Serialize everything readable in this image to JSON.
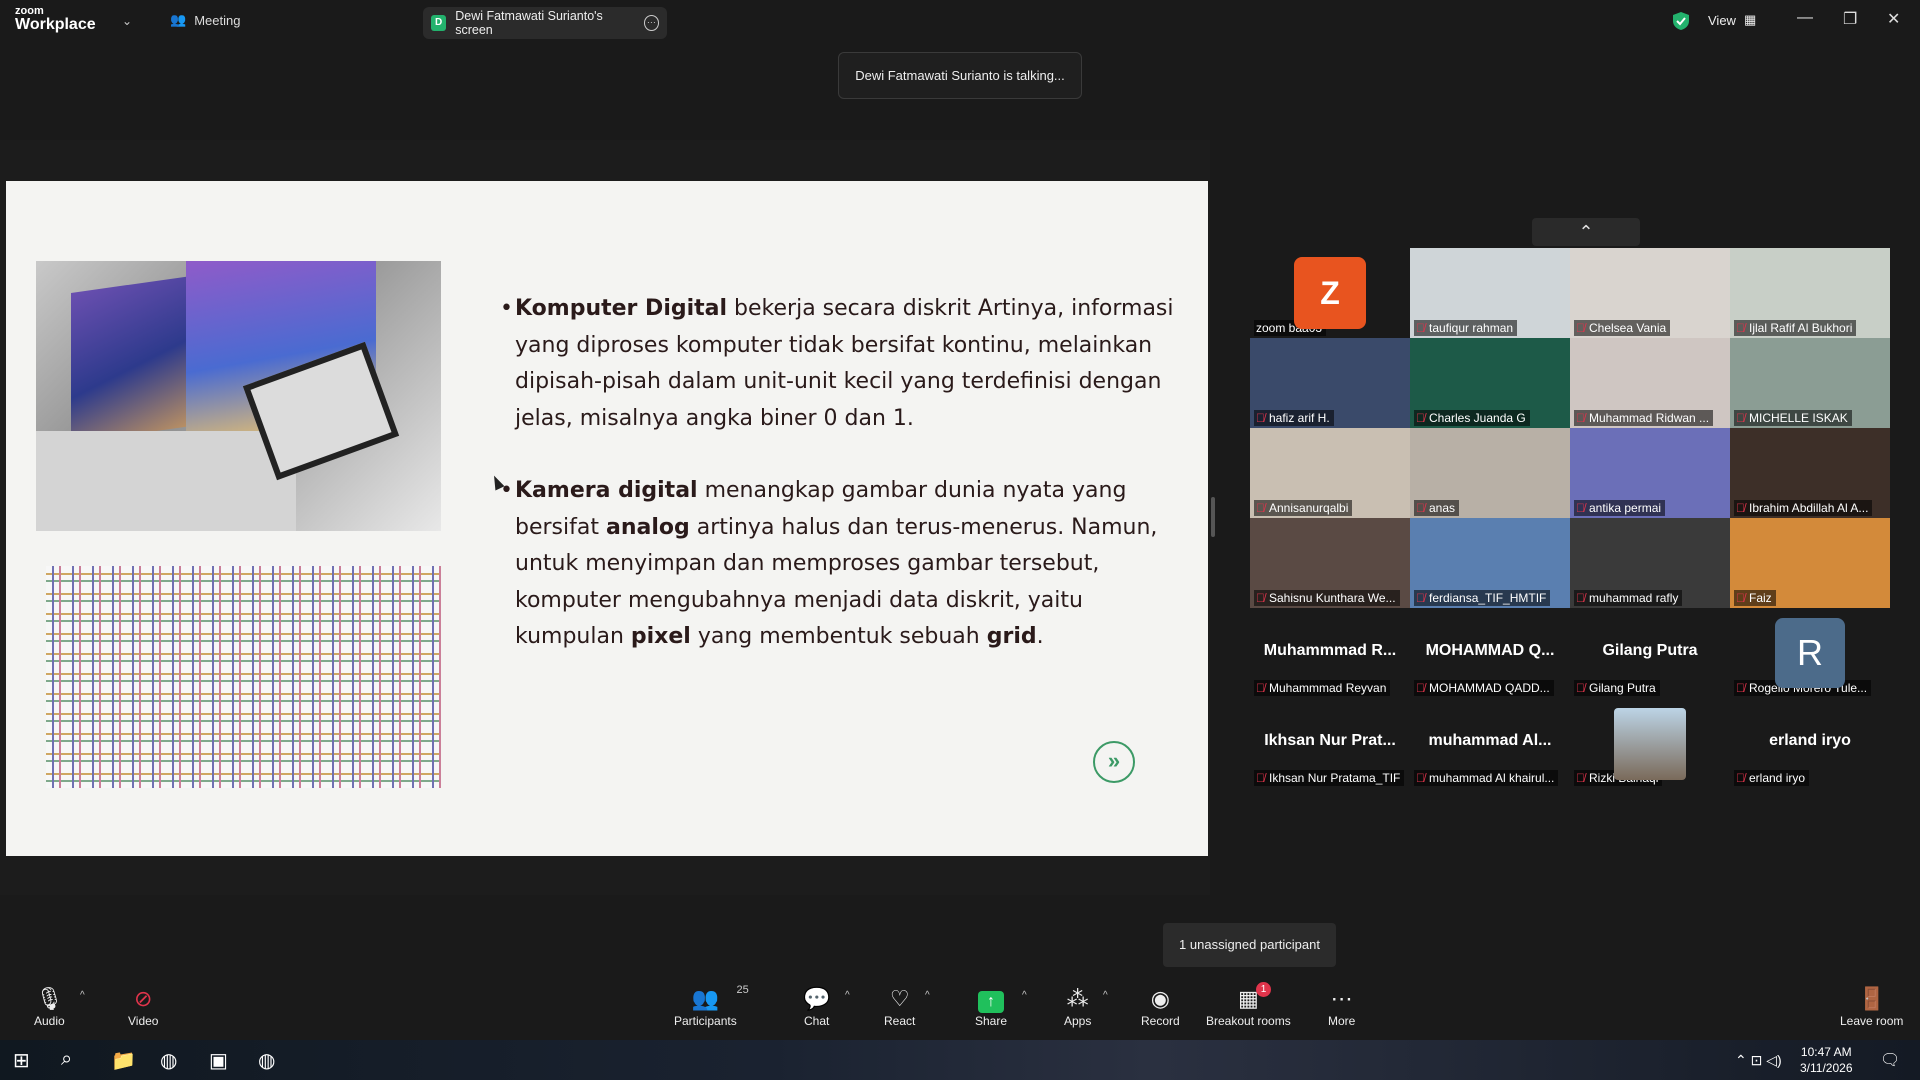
{
  "titlebar": {
    "logo_top": "zoom",
    "logo_bottom": "Workplace",
    "meeting_tab": "Meeting",
    "share_tab_initial": "D",
    "share_tab_label": "Dewi Fatmawati Surianto's screen",
    "view_label": "View"
  },
  "talking_banner": "Dewi Fatmawati Surianto is talking...",
  "slide": {
    "bullet1": {
      "bold": "Komputer Digital",
      "text": " bekerja secara diskrit Artinya, informasi yang diproses komputer tidak bersifat kontinu, melainkan dipisah-pisah dalam unit-unit kecil yang terdefinisi dengan jelas, misalnya angka biner 0 dan 1."
    },
    "bullet2": {
      "bold1": "Kamera digital",
      "text1": " menangkap gambar dunia nyata yang bersifat ",
      "bold2": "analog",
      "text2": " artinya halus dan terus-menerus. Namun, untuk menyimpan dan memproses gambar tersebut, komputer mengubahnya menjadi data diskrit, yaitu kumpulan ",
      "bold3": "pixel",
      "text3": " yang membentuk sebuah ",
      "bold4": "grid",
      "text4": "."
    },
    "next_icon": "double-chevron-right-icon"
  },
  "gallery": {
    "z_initial": "Z",
    "r_initial": "R",
    "tiles": [
      {
        "name": "zoom baa03"
      },
      {
        "name": "taufiqur rahman"
      },
      {
        "name": "Chelsea Vania"
      },
      {
        "name": "Ijlal Rafif Al Bukhori"
      },
      {
        "name": "hafiz arif H."
      },
      {
        "name": "Charles Juanda G"
      },
      {
        "name": "Muhammad Ridwan ..."
      },
      {
        "name": "MICHELLE ISKAK"
      },
      {
        "name": "Annisanurqalbi"
      },
      {
        "name": "anas"
      },
      {
        "name": "antika permai"
      },
      {
        "name": "Ibrahim Abdillah Al A..."
      },
      {
        "name": "Sahisnu Kunthara We..."
      },
      {
        "name": "ferdiansa_TIF_HMTIF"
      },
      {
        "name": "muhammad rafly"
      },
      {
        "name": "Faiz"
      },
      {
        "name": "Muhammmad Reyvan"
      },
      {
        "name": "MOHAMMAD QADD..."
      },
      {
        "name": "Gilang Putra"
      },
      {
        "name": "Rogelio Morero Tule..."
      },
      {
        "name": "Ikhsan Nur Pratama_TIF"
      },
      {
        "name": "muhammad Al khairul..."
      },
      {
        "name": "Rizki Baihaqi"
      },
      {
        "name": "erland iryo"
      }
    ],
    "big_names": [
      "Muhammmad R...",
      "MOHAMMAD Q...",
      "Gilang Putra",
      "Ikhsan Nur Prat...",
      "muhammad Al...",
      "erland iryo"
    ]
  },
  "unassigned": "1 unassigned participant",
  "toolbar": {
    "audio": "Audio",
    "video": "Video",
    "participants": "Participants",
    "participants_count": "25",
    "chat": "Chat",
    "react": "React",
    "share": "Share",
    "apps": "Apps",
    "record": "Record",
    "breakout": "Breakout rooms",
    "breakout_badge": "1",
    "more": "More",
    "leave": "Leave room"
  },
  "taskbar": {
    "time": "10:47 AM",
    "date": "3/11/2026"
  },
  "colors": {
    "accent_green": "#23b26d",
    "mute_red": "#e0344b",
    "avatar_orange": "#e8541f"
  }
}
